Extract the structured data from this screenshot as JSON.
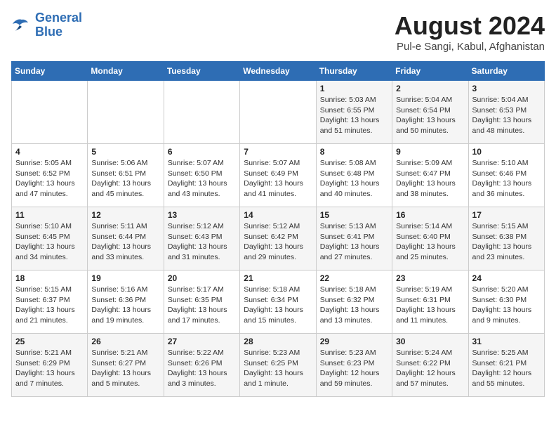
{
  "header": {
    "logo_line1": "General",
    "logo_line2": "Blue",
    "title": "August 2024",
    "subtitle": "Pul-e Sangi, Kabul, Afghanistan"
  },
  "days_of_week": [
    "Sunday",
    "Monday",
    "Tuesday",
    "Wednesday",
    "Thursday",
    "Friday",
    "Saturday"
  ],
  "weeks": [
    [
      {
        "day": "",
        "info": ""
      },
      {
        "day": "",
        "info": ""
      },
      {
        "day": "",
        "info": ""
      },
      {
        "day": "",
        "info": ""
      },
      {
        "day": "1",
        "info": "Sunrise: 5:03 AM\nSunset: 6:55 PM\nDaylight: 13 hours\nand 51 minutes."
      },
      {
        "day": "2",
        "info": "Sunrise: 5:04 AM\nSunset: 6:54 PM\nDaylight: 13 hours\nand 50 minutes."
      },
      {
        "day": "3",
        "info": "Sunrise: 5:04 AM\nSunset: 6:53 PM\nDaylight: 13 hours\nand 48 minutes."
      }
    ],
    [
      {
        "day": "4",
        "info": "Sunrise: 5:05 AM\nSunset: 6:52 PM\nDaylight: 13 hours\nand 47 minutes."
      },
      {
        "day": "5",
        "info": "Sunrise: 5:06 AM\nSunset: 6:51 PM\nDaylight: 13 hours\nand 45 minutes."
      },
      {
        "day": "6",
        "info": "Sunrise: 5:07 AM\nSunset: 6:50 PM\nDaylight: 13 hours\nand 43 minutes."
      },
      {
        "day": "7",
        "info": "Sunrise: 5:07 AM\nSunset: 6:49 PM\nDaylight: 13 hours\nand 41 minutes."
      },
      {
        "day": "8",
        "info": "Sunrise: 5:08 AM\nSunset: 6:48 PM\nDaylight: 13 hours\nand 40 minutes."
      },
      {
        "day": "9",
        "info": "Sunrise: 5:09 AM\nSunset: 6:47 PM\nDaylight: 13 hours\nand 38 minutes."
      },
      {
        "day": "10",
        "info": "Sunrise: 5:10 AM\nSunset: 6:46 PM\nDaylight: 13 hours\nand 36 minutes."
      }
    ],
    [
      {
        "day": "11",
        "info": "Sunrise: 5:10 AM\nSunset: 6:45 PM\nDaylight: 13 hours\nand 34 minutes."
      },
      {
        "day": "12",
        "info": "Sunrise: 5:11 AM\nSunset: 6:44 PM\nDaylight: 13 hours\nand 33 minutes."
      },
      {
        "day": "13",
        "info": "Sunrise: 5:12 AM\nSunset: 6:43 PM\nDaylight: 13 hours\nand 31 minutes."
      },
      {
        "day": "14",
        "info": "Sunrise: 5:12 AM\nSunset: 6:42 PM\nDaylight: 13 hours\nand 29 minutes."
      },
      {
        "day": "15",
        "info": "Sunrise: 5:13 AM\nSunset: 6:41 PM\nDaylight: 13 hours\nand 27 minutes."
      },
      {
        "day": "16",
        "info": "Sunrise: 5:14 AM\nSunset: 6:40 PM\nDaylight: 13 hours\nand 25 minutes."
      },
      {
        "day": "17",
        "info": "Sunrise: 5:15 AM\nSunset: 6:38 PM\nDaylight: 13 hours\nand 23 minutes."
      }
    ],
    [
      {
        "day": "18",
        "info": "Sunrise: 5:15 AM\nSunset: 6:37 PM\nDaylight: 13 hours\nand 21 minutes."
      },
      {
        "day": "19",
        "info": "Sunrise: 5:16 AM\nSunset: 6:36 PM\nDaylight: 13 hours\nand 19 minutes."
      },
      {
        "day": "20",
        "info": "Sunrise: 5:17 AM\nSunset: 6:35 PM\nDaylight: 13 hours\nand 17 minutes."
      },
      {
        "day": "21",
        "info": "Sunrise: 5:18 AM\nSunset: 6:34 PM\nDaylight: 13 hours\nand 15 minutes."
      },
      {
        "day": "22",
        "info": "Sunrise: 5:18 AM\nSunset: 6:32 PM\nDaylight: 13 hours\nand 13 minutes."
      },
      {
        "day": "23",
        "info": "Sunrise: 5:19 AM\nSunset: 6:31 PM\nDaylight: 13 hours\nand 11 minutes."
      },
      {
        "day": "24",
        "info": "Sunrise: 5:20 AM\nSunset: 6:30 PM\nDaylight: 13 hours\nand 9 minutes."
      }
    ],
    [
      {
        "day": "25",
        "info": "Sunrise: 5:21 AM\nSunset: 6:29 PM\nDaylight: 13 hours\nand 7 minutes."
      },
      {
        "day": "26",
        "info": "Sunrise: 5:21 AM\nSunset: 6:27 PM\nDaylight: 13 hours\nand 5 minutes."
      },
      {
        "day": "27",
        "info": "Sunrise: 5:22 AM\nSunset: 6:26 PM\nDaylight: 13 hours\nand 3 minutes."
      },
      {
        "day": "28",
        "info": "Sunrise: 5:23 AM\nSunset: 6:25 PM\nDaylight: 13 hours\nand 1 minute."
      },
      {
        "day": "29",
        "info": "Sunrise: 5:23 AM\nSunset: 6:23 PM\nDaylight: 12 hours\nand 59 minutes."
      },
      {
        "day": "30",
        "info": "Sunrise: 5:24 AM\nSunset: 6:22 PM\nDaylight: 12 hours\nand 57 minutes."
      },
      {
        "day": "31",
        "info": "Sunrise: 5:25 AM\nSunset: 6:21 PM\nDaylight: 12 hours\nand 55 minutes."
      }
    ]
  ]
}
